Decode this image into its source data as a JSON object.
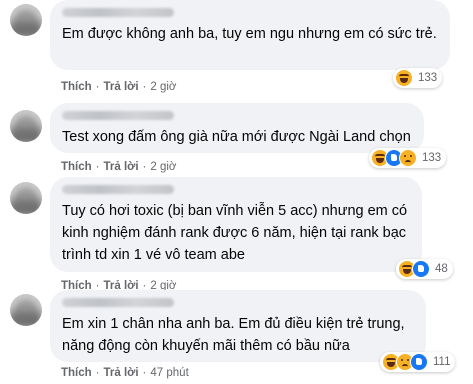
{
  "comments": [
    {
      "text": "Em được không anh ba, tuy em ngu nhưng em có sức trẻ.",
      "like_label": "Thích",
      "reply_label": "Trả lời",
      "time": "2 giờ",
      "reaction_count": "133",
      "reactions": [
        "haha-icon"
      ]
    },
    {
      "text": "Test xong đấm ông già nữa mới được Ngài Land chọn",
      "like_label": "Thích",
      "reply_label": "Trả lời",
      "time": "2 giờ",
      "reaction_count": "133",
      "reactions": [
        "haha-icon",
        "like-icon",
        "sad-icon"
      ]
    },
    {
      "text": "Tuy có hơi toxic (bị ban vĩnh viễn 5 acc) nhưng em có kinh nghiệm đánh rank được 6 năm, hiện tại rank bạc trình td xin 1 vé vô team abe",
      "like_label": "Thích",
      "reply_label": "Trả lời",
      "time": "2 giờ",
      "reaction_count": "48",
      "reactions": [
        "haha-icon",
        "like-icon"
      ]
    },
    {
      "text": "Em xin 1 chân nha anh ba. Em đủ điều kiện trẻ trung, năng động còn khuyến mãi thêm có bầu nữa",
      "like_label": "Thích",
      "reply_label": "Trả lời",
      "time": "47 phút",
      "reaction_count": "111",
      "reactions": [
        "haha-icon",
        "sad-icon",
        "like-icon"
      ]
    }
  ]
}
